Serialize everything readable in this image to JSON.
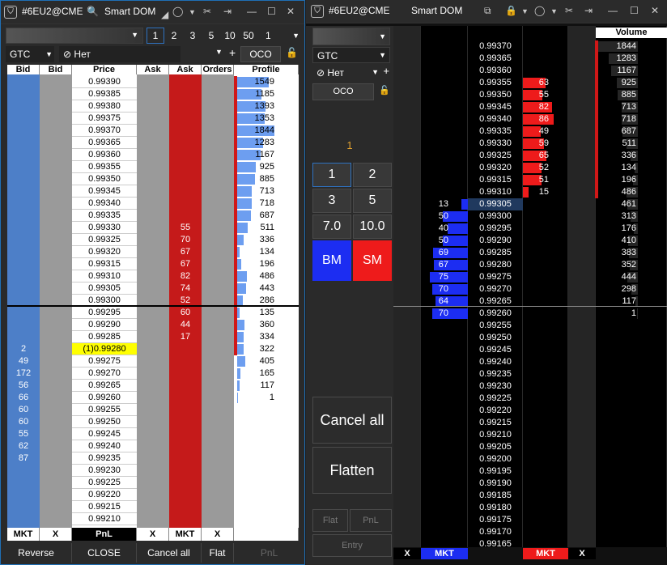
{
  "left": {
    "title": "#6EU2@CME",
    "dom": "Smart DOM",
    "tif": "GTC",
    "no_label": "Нет",
    "oco": "OCO",
    "qty_buttons": [
      "1",
      "2",
      "3",
      "5",
      "10",
      "50"
    ],
    "qty_input": "1",
    "headers": [
      "Bid",
      "Bid",
      "Price",
      "Ask",
      "Ask",
      "Orders",
      "Profile"
    ],
    "rows": [
      {
        "price": "0.99390",
        "profile": "1549"
      },
      {
        "price": "0.99385",
        "profile": "1185"
      },
      {
        "price": "0.99380",
        "profile": "1393"
      },
      {
        "price": "0.99375",
        "profile": "1353"
      },
      {
        "price": "0.99370",
        "profile": "1844"
      },
      {
        "price": "0.99365",
        "profile": "1283"
      },
      {
        "price": "0.99360",
        "profile": "1167"
      },
      {
        "price": "0.99355",
        "profile": "925"
      },
      {
        "price": "0.99350",
        "profile": "885"
      },
      {
        "price": "0.99345",
        "profile": "713"
      },
      {
        "price": "0.99340",
        "profile": "718"
      },
      {
        "price": "0.99335",
        "profile": "687"
      },
      {
        "price": "0.99330",
        "ask": "55",
        "profile": "511"
      },
      {
        "price": "0.99325",
        "ask": "70",
        "profile": "336"
      },
      {
        "price": "0.99320",
        "ask": "67",
        "profile": "134"
      },
      {
        "price": "0.99315",
        "ask": "67",
        "profile": "196"
      },
      {
        "price": "0.99310",
        "ask": "82",
        "profile": "486"
      },
      {
        "price": "0.99305",
        "ask": "74",
        "profile": "443"
      },
      {
        "price": "0.99300",
        "ask": "52",
        "profile": "286"
      },
      {
        "price": "0.99295",
        "ask": "60",
        "profile": "135"
      },
      {
        "price": "0.99290",
        "ask": "44",
        "profile": "360"
      },
      {
        "price": "0.99285",
        "ask": "17",
        "profile": "334"
      },
      {
        "price": "(1)0.99280",
        "bid": "2",
        "profile": "322"
      },
      {
        "price": "0.99275",
        "bid": "49",
        "profile": "405"
      },
      {
        "price": "0.99270",
        "bid": "172",
        "profile": "165"
      },
      {
        "price": "0.99265",
        "bid": "56",
        "profile": "117"
      },
      {
        "price": "0.99260",
        "bid": "66",
        "profile": "1"
      },
      {
        "price": "0.99255",
        "bid": "60"
      },
      {
        "price": "0.99250",
        "bid": "60"
      },
      {
        "price": "0.99245",
        "bid": "55"
      },
      {
        "price": "0.99240",
        "bid": "62"
      },
      {
        "price": "0.99235",
        "bid": "87"
      },
      {
        "price": "0.99230"
      },
      {
        "price": "0.99225"
      },
      {
        "price": "0.99220"
      },
      {
        "price": "0.99215"
      },
      {
        "price": "0.99210"
      }
    ],
    "footer": [
      "MKT",
      "X",
      "PnL",
      "X",
      "MKT",
      "X",
      ""
    ],
    "bottom": [
      "Reverse",
      "CLOSE",
      "Cancel all",
      "Flat",
      "PnL"
    ]
  },
  "right": {
    "title": "#6EU2@CME",
    "dom": "Smart DOM",
    "tif": "GTC",
    "no_label": "Нет",
    "oco": "OCO",
    "number": "1",
    "qty": [
      "1",
      "2",
      "3",
      "5",
      "7.0",
      "10.0"
    ],
    "bm": "BM",
    "sm": "SM",
    "cancel_all": "Cancel all",
    "flatten": "Flatten",
    "flat": "Flat",
    "pnl": "PnL",
    "entry": "Entry",
    "volume_header": "Volume",
    "rows": [
      {
        "price": "0.99370",
        "vol": "1844"
      },
      {
        "price": "0.99365",
        "vol": "1283"
      },
      {
        "price": "0.99360",
        "vol": "1167"
      },
      {
        "price": "0.99355",
        "ask": "63",
        "vol": "925"
      },
      {
        "price": "0.99350",
        "ask": "55",
        "vol": "885"
      },
      {
        "price": "0.99345",
        "ask": "82",
        "vol": "713"
      },
      {
        "price": "0.99340",
        "ask": "86",
        "vol": "718"
      },
      {
        "price": "0.99335",
        "ask": "49",
        "vol": "687"
      },
      {
        "price": "0.99330",
        "ask": "59",
        "vol": "511"
      },
      {
        "price": "0.99325",
        "ask": "65",
        "vol": "336"
      },
      {
        "price": "0.99320",
        "ask": "52",
        "vol": "134"
      },
      {
        "price": "0.99315",
        "ask": "51",
        "vol": "196"
      },
      {
        "price": "0.99310",
        "ask": "15",
        "vol": "486"
      },
      {
        "price": "0.99305",
        "bid": "13",
        "vol": "461"
      },
      {
        "price": "0.99300",
        "bid": "50",
        "vol": "313"
      },
      {
        "price": "0.99295",
        "bid": "40",
        "vol": "176"
      },
      {
        "price": "0.99290",
        "bid": "50",
        "vol": "410"
      },
      {
        "price": "0.99285",
        "bid": "69",
        "vol": "383"
      },
      {
        "price": "0.99280",
        "bid": "67",
        "vol": "352"
      },
      {
        "price": "0.99275",
        "bid": "75",
        "vol": "444"
      },
      {
        "price": "0.99270",
        "bid": "70",
        "vol": "298"
      },
      {
        "price": "0.99265",
        "bid": "64",
        "vol": "117"
      },
      {
        "price": "0.99260",
        "bid": "70",
        "vol": "1"
      },
      {
        "price": "0.99255"
      },
      {
        "price": "0.99250"
      },
      {
        "price": "0.99245"
      },
      {
        "price": "0.99240"
      },
      {
        "price": "0.99235"
      },
      {
        "price": "0.99230"
      },
      {
        "price": "0.99225"
      },
      {
        "price": "0.99220"
      },
      {
        "price": "0.99215"
      },
      {
        "price": "0.99210"
      },
      {
        "price": "0.99205"
      },
      {
        "price": "0.99200"
      },
      {
        "price": "0.99195"
      },
      {
        "price": "0.99190"
      },
      {
        "price": "0.99185"
      },
      {
        "price": "0.99180"
      },
      {
        "price": "0.99175"
      },
      {
        "price": "0.99170"
      },
      {
        "price": "0.99165"
      }
    ],
    "footer": [
      "X",
      "MKT",
      "MKT",
      "X"
    ]
  }
}
